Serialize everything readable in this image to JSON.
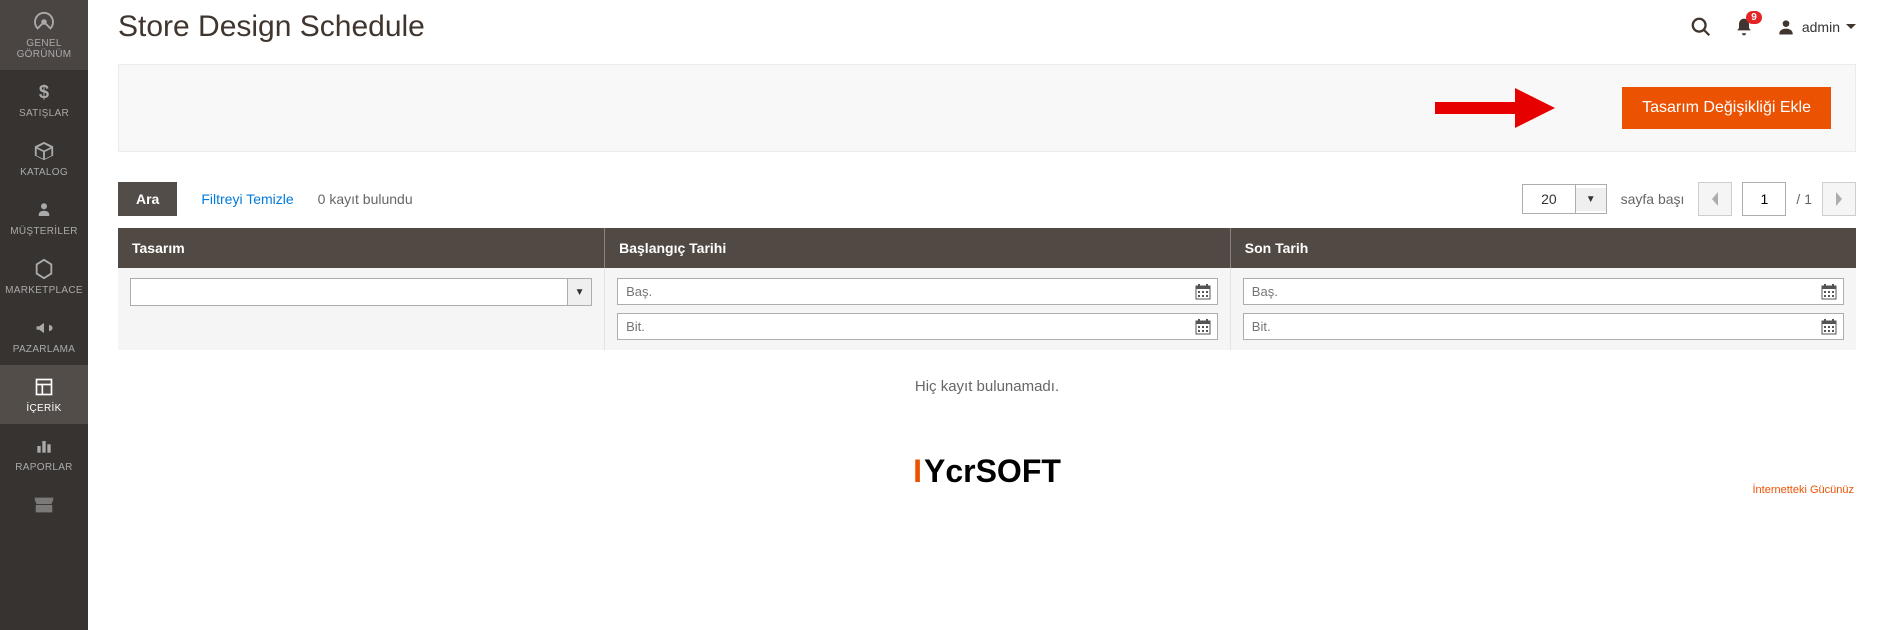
{
  "sidebar": {
    "items": [
      {
        "label": "GENEL GÖRÜNÜM",
        "icon": "dashboard"
      },
      {
        "label": "SATIŞLAR",
        "icon": "dollar"
      },
      {
        "label": "KATALOG",
        "icon": "box"
      },
      {
        "label": "MÜŞTERİLER",
        "icon": "person"
      },
      {
        "label": "MARKETPLACE",
        "icon": "hexagon"
      },
      {
        "label": "PAZARLAMA",
        "icon": "megaphone"
      },
      {
        "label": "İÇERİK",
        "icon": "layout",
        "active": true
      },
      {
        "label": "RAPORLAR",
        "icon": "bars"
      },
      {
        "label": "",
        "icon": "stores"
      }
    ]
  },
  "header": {
    "title": "Store Design Schedule",
    "notifications_count": "9",
    "user_label": "admin"
  },
  "action_bar": {
    "primary_button": "Tasarım Değişikliği Ekle"
  },
  "toolbar": {
    "search_label": "Ara",
    "reset_label": "Filtreyi Temizle",
    "records_found": "0 kayıt bulundu",
    "page_size": "20",
    "per_page_label": "sayfa başı",
    "current_page": "1",
    "total_pages": "/ 1"
  },
  "grid": {
    "columns": {
      "design": "Tasarım",
      "date_from": "Başlangıç Tarihi",
      "date_to": "Son Tarih"
    },
    "filter_placeholders": {
      "from": "Baş.",
      "to": "Bit."
    },
    "empty_message": "Hiç kayıt bulunamadı."
  },
  "footer": {
    "logo_text": "YcrSOFT",
    "logo_sub": "İnternetteki Gücünüz"
  }
}
